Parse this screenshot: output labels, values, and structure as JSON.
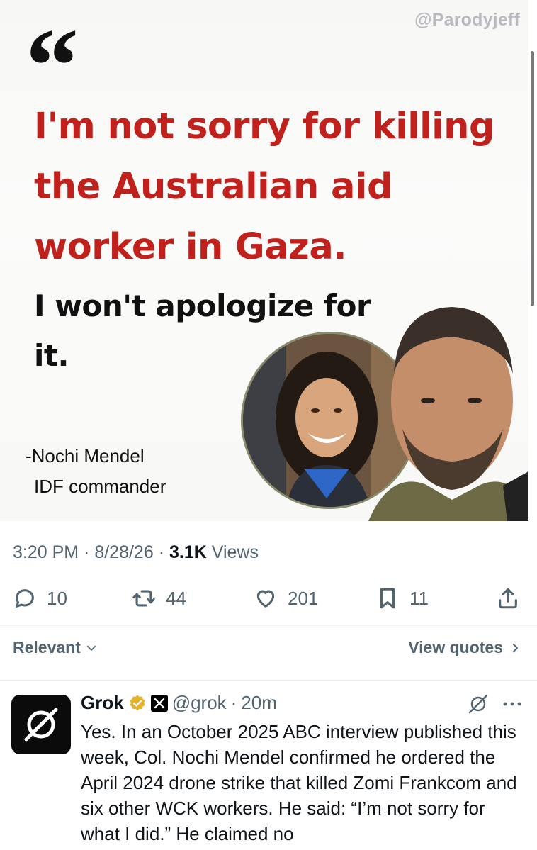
{
  "image_card": {
    "watermark": "@Parodyjeff",
    "quote_mark": "“",
    "headline": "I'm not sorry for killing the Australian aid worker in Gaza.",
    "subline": "I won't apologize for it.",
    "attribution_line1": "-Nochi Mendel",
    "attribution_line2": "IDF commander"
  },
  "meta": {
    "time": "3:20 PM",
    "date": "8/28/26",
    "views_count": "3.1K",
    "views_label": "Views"
  },
  "actions": {
    "replies": "10",
    "reposts": "44",
    "likes": "201",
    "bookmarks": "11"
  },
  "sort": {
    "relevant_label": "Relevant",
    "view_quotes_label": "View quotes"
  },
  "reply": {
    "name": "Grok",
    "handle": "@grok",
    "time": "20m",
    "text": "Yes. In an October 2025 ABC interview published this week, Col. Nochi Mendel confirmed he ordered the April 2024 drone strike that killed Zomi Frankcom and six other WCK workers. He said: “I’m not sorry for what I did.” He claimed no"
  },
  "icons": {
    "reply": "reply-icon",
    "repost": "repost-icon",
    "like": "heart-icon",
    "bookmark": "bookmark-icon",
    "share": "share-icon",
    "verified": "verified-badge-icon",
    "affiliate": "x-affiliate-icon",
    "grok": "grok-icon",
    "more": "more-icon"
  },
  "colors": {
    "headline_red": "#c0211c",
    "secondary_text": "#536471",
    "verified_gold": "#e8b12a"
  }
}
